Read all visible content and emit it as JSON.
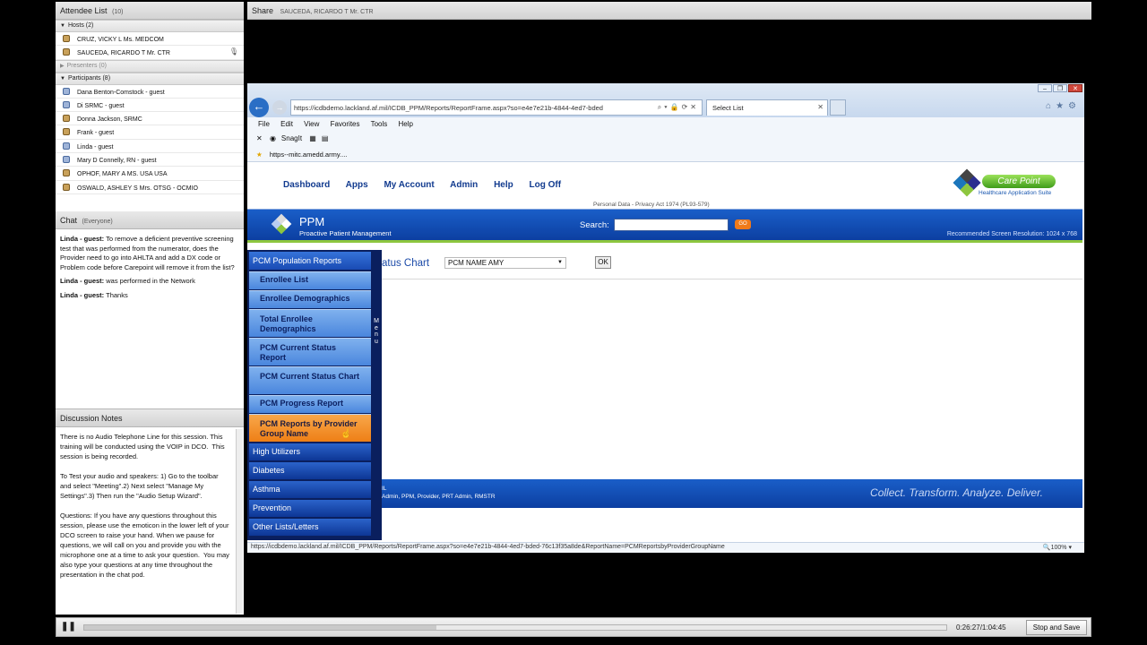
{
  "attendees": {
    "title": "Attendee List",
    "count": "(10)",
    "hosts_label": "Hosts (2)",
    "hosts": [
      "CRUZ, VICKY L Ms. MEDCOM",
      "SAUCEDA, RICARDO T Mr. CTR"
    ],
    "presenters_label": "Presenters (0)",
    "participants_label": "Participants (8)",
    "participants": [
      "Dana Benton-Comstock - guest",
      "Di SRMC - guest",
      "Donna Jackson, SRMC",
      "Frank - guest",
      "Linda - guest",
      "Mary D Connelly, RN - guest",
      "OPHOF, MARY A MS. USA USA",
      "OSWALD, ASHLEY S Mrs. OTSG - OCMIO"
    ]
  },
  "chat": {
    "title": "Chat",
    "scope": "(Everyone)",
    "messages": [
      {
        "author": "Linda - guest:",
        "text": " To remove a  deficient preventive screening test that was performed from the numerator, does the Provider need to go into AHLTA and add a DX code or Problem code before Carepoint will remove it from the list?"
      },
      {
        "author": "Linda - guest:",
        "text": " was performed in the Network"
      },
      {
        "author": "Linda - guest:",
        "text": " Thanks"
      }
    ]
  },
  "notes": {
    "title": "Discussion Notes",
    "body": "There is no Audio Telephone Line for this session. This training will be conducted using the VOIP in DCO.  This session is being recorded.\n\nTo Test your audio and speakers: 1) Go to the toolbar and select \"Meeting\".2) Next select \"Manage My Settings\".3) Then run the \"Audio Setup Wizard\".\n\nQuestions: If you have any questions throughout this session, please use the emoticon in the lower left of your DCO screen to raise your hand. When we pause for questions, we will call on you and provide you with the microphone one at a time to ask your question.  You may also type your questions at any time throughout the presentation in the chat pod."
  },
  "share": {
    "title": "Share",
    "presenter": "SAUCEDA, RICARDO T Mr. CTR"
  },
  "browser": {
    "url": "https://icdbdemo.lackland.af.mil/ICDB_PPM/Reports/ReportFrame.aspx?so=e4e7e21b-4844-4ed7-bded",
    "tab_title": "Select List",
    "menu": [
      "File",
      "Edit",
      "View",
      "Favorites",
      "Tools",
      "Help"
    ],
    "snagit": "SnagIt",
    "favorite": "https--mitc.amedd.army....",
    "status_url": "https://icdbdemo.lackland.af.mil/ICDB_PPM/Reports/ReportFrame.aspx?so=e4e7e21b-4844-4ed7-bded-76c13f35a8de&ReportName=PCMReportsbyProviderGroupName",
    "zoom": "100%"
  },
  "site": {
    "nav": [
      "Dashboard",
      "Apps",
      "My Account",
      "Admin",
      "Help",
      "Log Off"
    ],
    "logo_text": "Care Point",
    "logo_tag": "Healthcare Application Suite",
    "privacy": "Personal Data - Privacy Act 1974 (PL93-579)",
    "app_title": "PPM",
    "app_subtitle": "Proactive Patient Management",
    "search_label": "Search:",
    "go_label": "GO",
    "resolution": "Recommended Screen Resolution: 1024 x 768",
    "content_title": "atus Chart",
    "select_value": "PCM NAME AMY",
    "ok_label": "OK",
    "footer_roles_1": "IL",
    "footer_roles_2": "Admin, PPM, Provider, PRT Admin, RMSTR",
    "slogan": "Collect. Transform. Analyze. Deliver."
  },
  "flyout": {
    "header": "PCM Population Reports",
    "items": [
      "Enrollee List",
      "Enrollee Demographics",
      "Total Enrollee Demographics",
      "PCM Current Status Report",
      "PCM Current Status Chart",
      "PCM Progress Report",
      "PCM Reports by Provider Group Name"
    ],
    "categories": [
      "High Utilizers",
      "Diabetes",
      "Asthma",
      "Prevention",
      "Other Lists/Letters"
    ],
    "tab_label": "Menu"
  },
  "playback": {
    "time": "0:26:27/1:04:45",
    "progress": 0.409,
    "stop_label": "Stop and Save"
  },
  "colors": {
    "banner_blue": "#0c3fa1",
    "accent_green": "#8dc63f",
    "active_orange": "#ee7f16",
    "link_blue": "#123b8f"
  }
}
